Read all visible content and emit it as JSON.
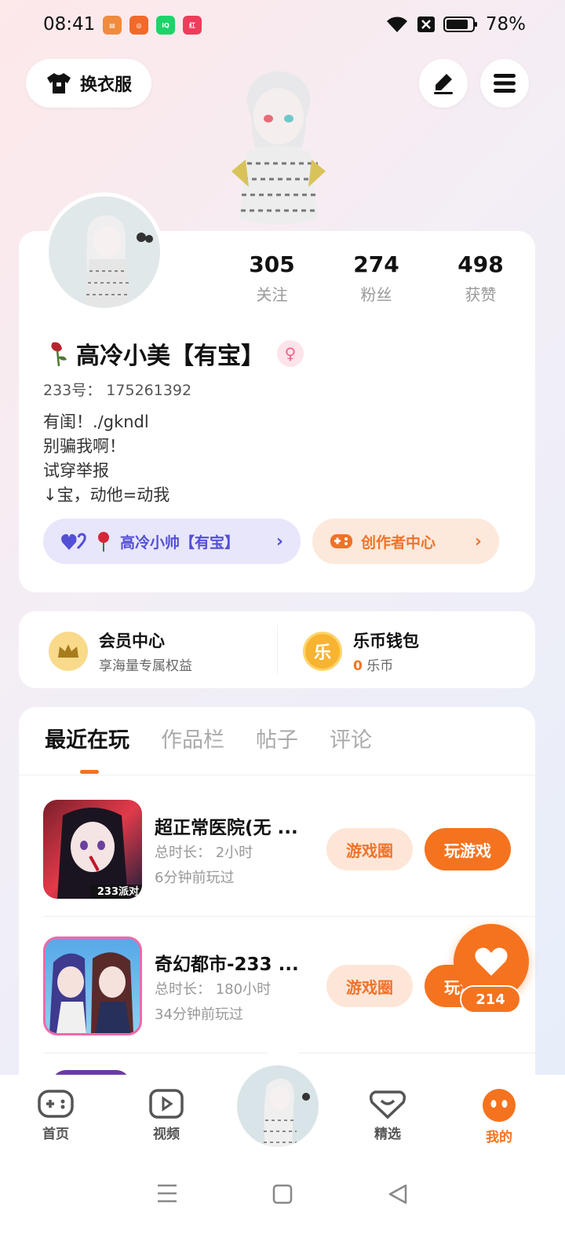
{
  "status_bar": {
    "time": "08:41",
    "battery": "78%"
  },
  "top_actions": {
    "dress_up_label": "换衣服"
  },
  "profile": {
    "stats": [
      {
        "value": "305",
        "label": "关注"
      },
      {
        "value": "274",
        "label": "粉丝"
      },
      {
        "value": "498",
        "label": "获赞"
      }
    ],
    "nickname": "高冷小美【有宝】",
    "uid": "233号： 175261392",
    "bio": [
      "有闺！.∕gkndl",
      "别骗我啊！",
      "试穿举报",
      "↓宝，动他=动我"
    ],
    "partner_link": "高冷小帅【有宝】",
    "creator_center": "创作者中心"
  },
  "vip": {
    "member_title": "会员中心",
    "member_sub": "享海量专属权益",
    "wallet_title": "乐币钱包",
    "wallet_amount": "0",
    "wallet_unit": "乐币"
  },
  "tabs": [
    "最近在玩",
    "作品栏",
    "帖子",
    "评论"
  ],
  "games": [
    {
      "title": "超正常医院(无 ...",
      "duration": "总时长： 2小时",
      "last_played": "6分钟前玩过",
      "circle_label": "游戏圈",
      "play_label": "玩游戏",
      "thumb_badge": "233派对"
    },
    {
      "title": "奇幻都市-233 ...",
      "duration": "总时长： 180小时",
      "last_played": "34分钟前玩过",
      "circle_label": "游戏圈",
      "play_label": "玩游戏"
    }
  ],
  "float_like": {
    "count": "214"
  },
  "bottom_nav": [
    {
      "label": "首页"
    },
    {
      "label": "视频"
    },
    {
      "label": "精选"
    },
    {
      "label": "我的"
    }
  ],
  "colors": {
    "accent": "#f5731e",
    "partner": "#5450d6"
  }
}
